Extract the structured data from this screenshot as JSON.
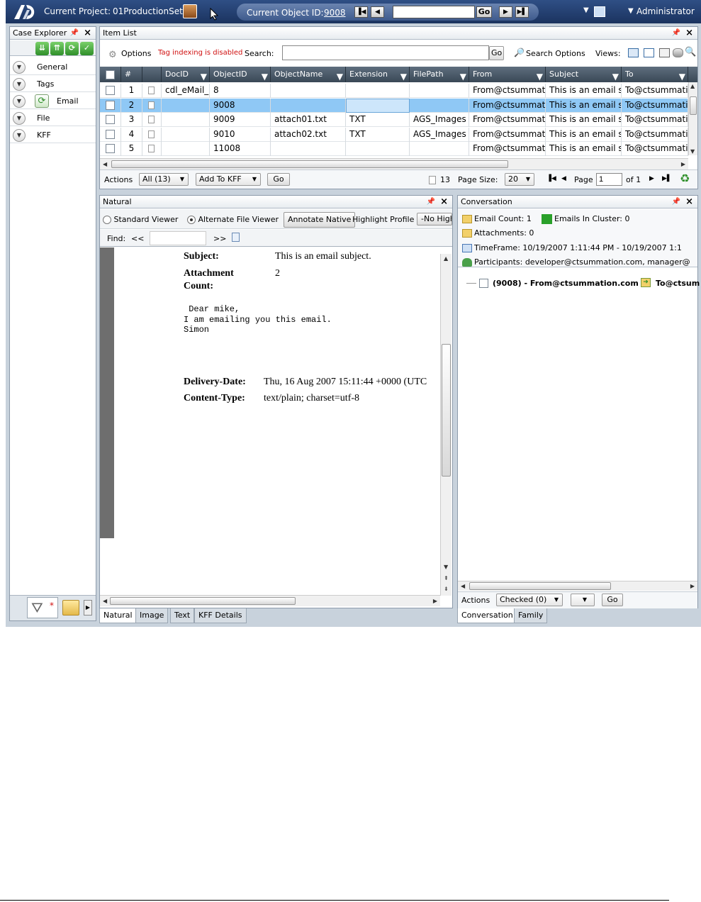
{
  "topbar": {
    "project_label": "Current Project:",
    "project_name": "01ProductionSet",
    "object_label": "Current Object ID:",
    "object_id": "9008",
    "go": "Go",
    "user": "Administrator"
  },
  "case_explorer": {
    "title": "Case Explorer",
    "items": [
      {
        "label": "General"
      },
      {
        "label": "Tags"
      },
      {
        "label": "Email"
      },
      {
        "label": "File"
      },
      {
        "label": "KFF"
      }
    ]
  },
  "item_list": {
    "title": "Item List",
    "options": "Options",
    "tag_warning": "Tag indexing is disabled",
    "search_label": "Search:",
    "search_value": "",
    "go": "Go",
    "search_options": "Search Options",
    "views_label": "Views:",
    "columns": [
      "#",
      "DocID",
      "ObjectID",
      "ObjectName",
      "Extension",
      "FilePath",
      "From",
      "Subject",
      "To"
    ],
    "rows": [
      {
        "num": "1",
        "docid": "cdl_eMail_",
        "objectid": "8",
        "name": "",
        "ext": "",
        "path": "",
        "from": "From@ctsummat",
        "subject": "This is an email s",
        "to": "To@ctsummati"
      },
      {
        "num": "2",
        "docid": "",
        "objectid": "9008",
        "name": "",
        "ext": "",
        "path": "",
        "from": "From@ctsummat",
        "subject": "This is an email s",
        "to": "To@ctsummati"
      },
      {
        "num": "3",
        "docid": "",
        "objectid": "9009",
        "name": "attach01.txt",
        "ext": "TXT",
        "path": "AGS_Images",
        "from": "From@ctsummat",
        "subject": "This is an email s",
        "to": "To@ctsummati"
      },
      {
        "num": "4",
        "docid": "",
        "objectid": "9010",
        "name": "attach02.txt",
        "ext": "TXT",
        "path": "AGS_Images",
        "from": "From@ctsummat",
        "subject": "This is an email s",
        "to": "To@ctsummati"
      },
      {
        "num": "5",
        "docid": "",
        "objectid": "11008",
        "name": "",
        "ext": "",
        "path": "",
        "from": "From@ctsummat",
        "subject": "This is an email s",
        "to": "To@ctsummati"
      }
    ],
    "footer": {
      "actions_label": "Actions",
      "all_select": "All (13)",
      "add_kff": "Add To KFF",
      "go": "Go",
      "count": "13",
      "page_size_label": "Page Size:",
      "page_size": "20",
      "page_label": "Page",
      "page_value": "1",
      "of_label": "of 1"
    }
  },
  "natural": {
    "title": "Natural",
    "standard_viewer": "Standard Viewer",
    "alternate_viewer": "Alternate File Viewer",
    "annotate": "Annotate Native",
    "highlight_profile": "Highlight Profile",
    "no_highlight": "-No Highl",
    "find_label": "Find:",
    "find_prev": "<<",
    "find_next": ">>",
    "doc": {
      "subject_label": "Subject:",
      "subject_value": "This is an email subject.",
      "attach_label_1": "Attachment",
      "attach_label_2": "Count:",
      "attach_value": "2",
      "body_1": " Dear mike,",
      "body_2": "I am emailing you this email.",
      "body_3": "Simon",
      "delivery_label": "Delivery-Date:",
      "delivery_value": "Thu, 16 Aug 2007 15:11:44 +0000 (UTC",
      "content_label": "Content-Type:",
      "content_value": "text/plain; charset=utf-8"
    },
    "tabs": [
      "Natural",
      "Image",
      "Text",
      "KFF Details"
    ]
  },
  "conversation": {
    "title": "Conversation",
    "email_count": "Email Count:  1",
    "emails_in_cluster": "Emails In Cluster:   0",
    "attachments": "Attachments:  0",
    "timeframe": "TimeFrame:  10/19/2007 1:11:44 PM - 10/19/2007 1:1",
    "participants": "Participants:  developer@ctsummation.com,  manager@",
    "tree_item": "(9008) - From@ctsummation.com",
    "tree_to": "To@ctsum",
    "actions_label": "Actions",
    "checked_select": "Checked (0)",
    "go": "Go",
    "tabs": [
      "Conversation",
      "Family"
    ]
  },
  "colors": {
    "topbar": "#1b335f",
    "selected_row": "#8fc8f5",
    "warning_text": "#d01010",
    "green_icon": "#2f8f2a"
  }
}
